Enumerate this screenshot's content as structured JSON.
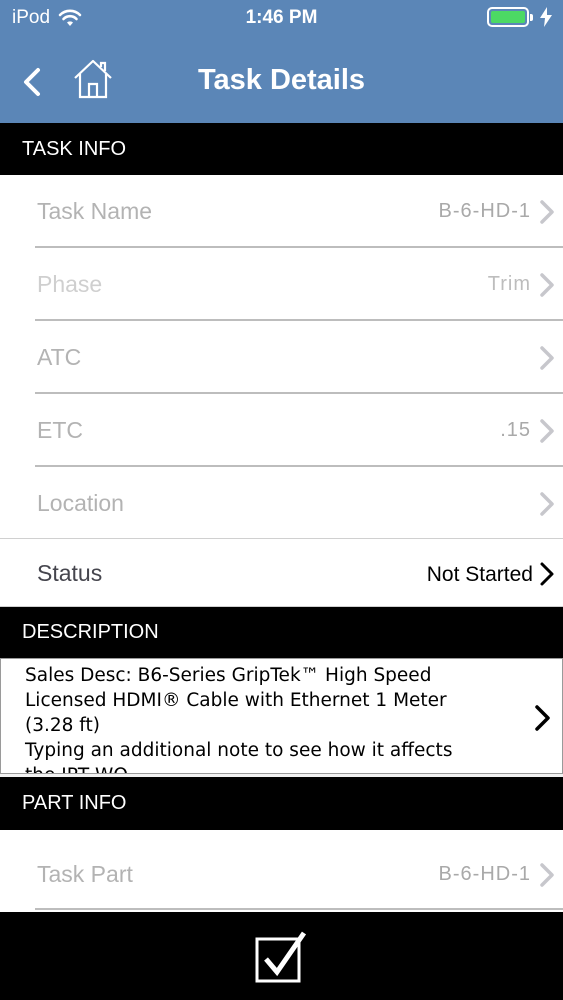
{
  "status_bar": {
    "carrier": "iPod",
    "time": "1:46 PM"
  },
  "header": {
    "title": "Task Details",
    "background_color": "#5b86b7"
  },
  "sections": {
    "task_info": "TASK INFO",
    "description": "DESCRIPTION",
    "part_info": "PART INFO"
  },
  "task_info_rows": [
    {
      "label": "Task Name",
      "value": "B-6-HD-1"
    },
    {
      "label": "Phase",
      "value": "Trim"
    },
    {
      "label": "ATC",
      "value": ""
    },
    {
      "label": "ETC",
      "value": ".15"
    },
    {
      "label": "Location",
      "value": ""
    }
  ],
  "status": {
    "label": "Status",
    "value": "Not Started"
  },
  "description": {
    "text": "Sales Desc: B6-Series GripTek™ High Speed\nLicensed HDMI® Cable with Ethernet 1 Meter\n(3.28 ft)\nTyping an additional note to see how it affects\nthe IPT WO"
  },
  "part_info_rows": [
    {
      "label": "Task Part",
      "value": "B-6-HD-1"
    }
  ],
  "icons": {
    "back": "chevron-left-icon",
    "home": "home-icon",
    "wifi": "wifi-icon",
    "battery": "battery-icon",
    "charging": "bolt-icon",
    "chevron": "chevron-right-icon",
    "save": "checkbox-icon"
  }
}
